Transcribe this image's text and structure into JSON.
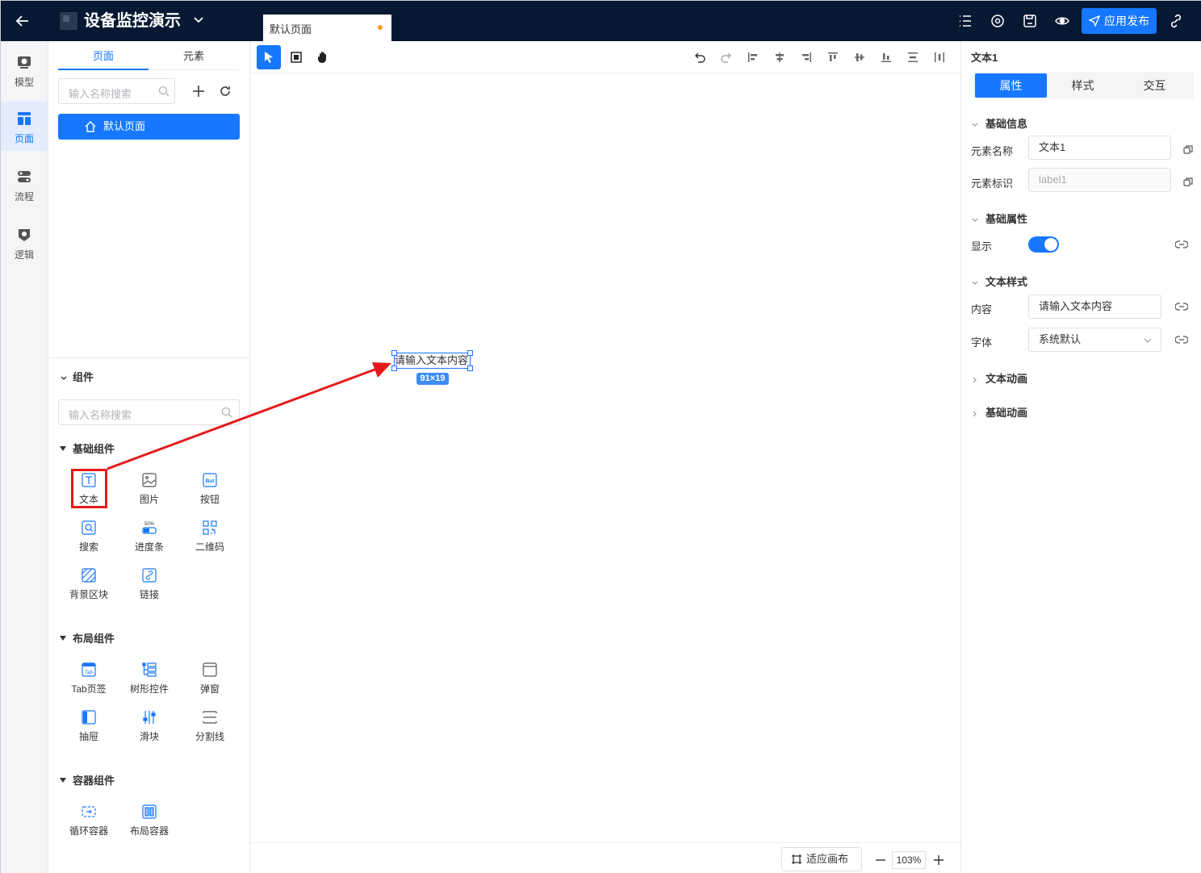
{
  "app": {
    "title": "设备监控演示"
  },
  "tabs": [
    {
      "label": "默认页面",
      "modified": true
    }
  ],
  "topbar": {
    "publish_label": "应用发布"
  },
  "rail": {
    "items": [
      {
        "label": "模型",
        "icon": "model-icon"
      },
      {
        "label": "页面",
        "icon": "page-icon",
        "active": true
      },
      {
        "label": "流程",
        "icon": "flow-icon"
      },
      {
        "label": "逻辑",
        "icon": "logic-icon"
      }
    ]
  },
  "page_panel": {
    "tabs": [
      "页面",
      "元素"
    ],
    "active_tab": "页面",
    "search_placeholder": "输入名称搜索",
    "pages": [
      {
        "label": "默认页面",
        "selected": true
      }
    ]
  },
  "components": {
    "header": "组件",
    "search_placeholder": "输入名称搜索",
    "groups": [
      {
        "title": "基础组件",
        "items": [
          "文本",
          "图片",
          "按钮",
          "搜索",
          "进度条",
          "二维码",
          "背景区块",
          "链接"
        ]
      },
      {
        "title": "布局组件",
        "items": [
          "Tab页签",
          "树形控件",
          "弹窗",
          "抽屉",
          "滑块",
          "分割线"
        ]
      },
      {
        "title": "容器组件",
        "items": [
          "循环容器",
          "布局容器"
        ]
      }
    ],
    "icon_texts": {
      "button": "But",
      "progress": "50%",
      "tab": "Tab"
    }
  },
  "canvas": {
    "text_element": "请输入文本内容",
    "size_badge": "91×19",
    "fit_label": "适应画布",
    "zoom": "103%"
  },
  "properties": {
    "element_title": "文本1",
    "tabs": [
      "属性",
      "样式",
      "交互"
    ],
    "active_tab": "属性",
    "sections": {
      "basic_info": "基础信息",
      "basic_props": "基础属性",
      "text_style": "文本样式",
      "text_anim": "文本动画",
      "basic_anim": "基础动画"
    },
    "fields": {
      "name_label": "元素名称",
      "name_value": "文本1",
      "id_label": "元素标识",
      "id_value": "label1",
      "show_label": "显示",
      "show_value": true,
      "content_label": "内容",
      "content_value": "请输入文本内容",
      "font_label": "字体",
      "font_value": "系统默认"
    }
  },
  "colors": {
    "primary": "#1677ff",
    "topbar": "#071833",
    "annotation": "#e5191b",
    "modified_dot": "#f0a020"
  }
}
